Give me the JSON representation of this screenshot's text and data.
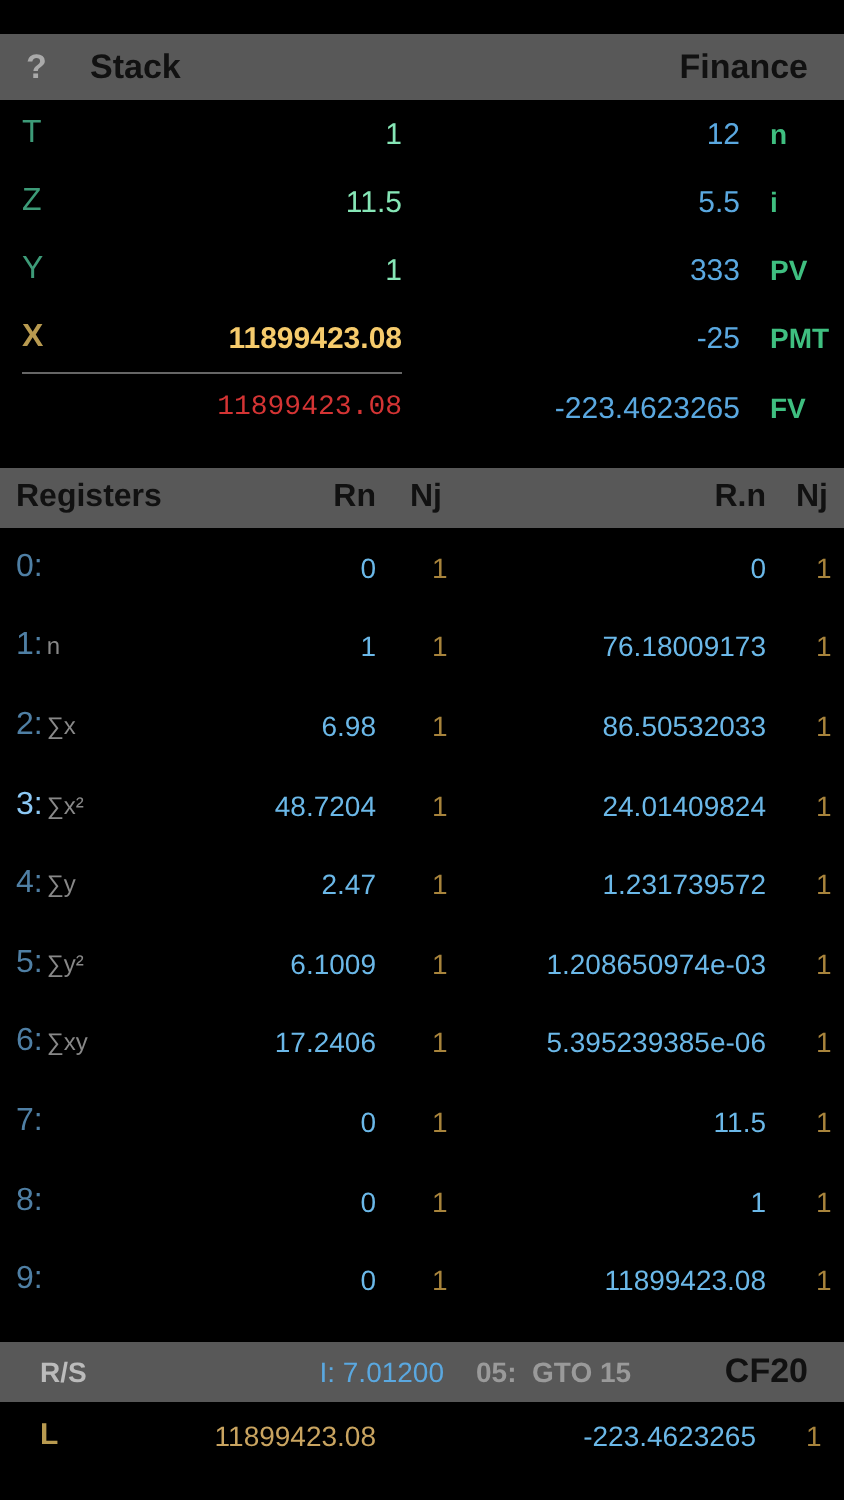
{
  "header": {
    "help": "?",
    "title": "Stack",
    "right_title": "Finance"
  },
  "stack": [
    {
      "kind": "plain",
      "label": "T",
      "value": "1",
      "fin_value": "12",
      "fin_label": "n"
    },
    {
      "kind": "plain",
      "label": "Z",
      "value": "11.5",
      "fin_value": "5.5",
      "fin_label": "i"
    },
    {
      "kind": "plain",
      "label": "Y",
      "value": "1",
      "fin_value": "333",
      "fin_label": "PV"
    },
    {
      "kind": "x",
      "label": "X",
      "value": "11899423.08",
      "fin_value": "-25",
      "fin_label": "PMT"
    }
  ],
  "last_x": {
    "value": "11899423.08",
    "fin_value": "-223.4623265",
    "fin_label": "FV"
  },
  "registers_header": {
    "title": "Registers",
    "col_rn": "Rn",
    "col_nj": "Nj",
    "col_rdn": "R.n",
    "col_nj_2": "Nj"
  },
  "registers": [
    {
      "index": "0:",
      "rn": "0",
      "nj": "1",
      "rdn": "0",
      "nj_2": "1",
      "selected": false
    },
    {
      "index": "1:",
      "name": "n",
      "rn": "1",
      "nj": "1",
      "rdn": "76.18009173",
      "nj_2": "1",
      "selected": false
    },
    {
      "index": "2:",
      "name": "∑x",
      "rn": "6.98",
      "nj": "1",
      "rdn": "86.50532033",
      "nj_2": "1",
      "selected": false
    },
    {
      "index": "3:",
      "name": "∑x²",
      "rn": "48.7204",
      "nj": "1",
      "rdn": "24.01409824",
      "nj_2": "1",
      "selected": true
    },
    {
      "index": "4:",
      "name": "∑y",
      "rn": "2.47",
      "nj": "1",
      "rdn": "1.231739572",
      "nj_2": "1",
      "selected": false
    },
    {
      "index": "5:",
      "name": "∑y²",
      "rn": "6.1009",
      "nj": "1",
      "rdn": "1.208650974e-03",
      "nj_2": "1",
      "selected": false
    },
    {
      "index": "6:",
      "name": "∑xy",
      "rn": "17.2406",
      "nj": "1",
      "rdn": "5.395239385e-06",
      "nj_2": "1",
      "selected": false
    },
    {
      "index": "7:",
      "rn": "0",
      "nj": "1",
      "rdn": "11.5",
      "nj_2": "1",
      "selected": false
    },
    {
      "index": "8:",
      "rn": "0",
      "nj": "1",
      "rdn": "1",
      "nj_2": "1",
      "selected": false
    },
    {
      "index": "9:",
      "rn": "0",
      "nj": "1",
      "rdn": "11899423.08",
      "nj_2": "1",
      "selected": false
    }
  ],
  "footer": {
    "run": "R/S",
    "i_register": "I: 7.01200",
    "step": "05:  GTO 15",
    "cash_flow": "CF20"
  },
  "l_row": {
    "label": "L",
    "value": "11899423.08",
    "value_2": "-223.4623265",
    "nj": "1"
  }
}
